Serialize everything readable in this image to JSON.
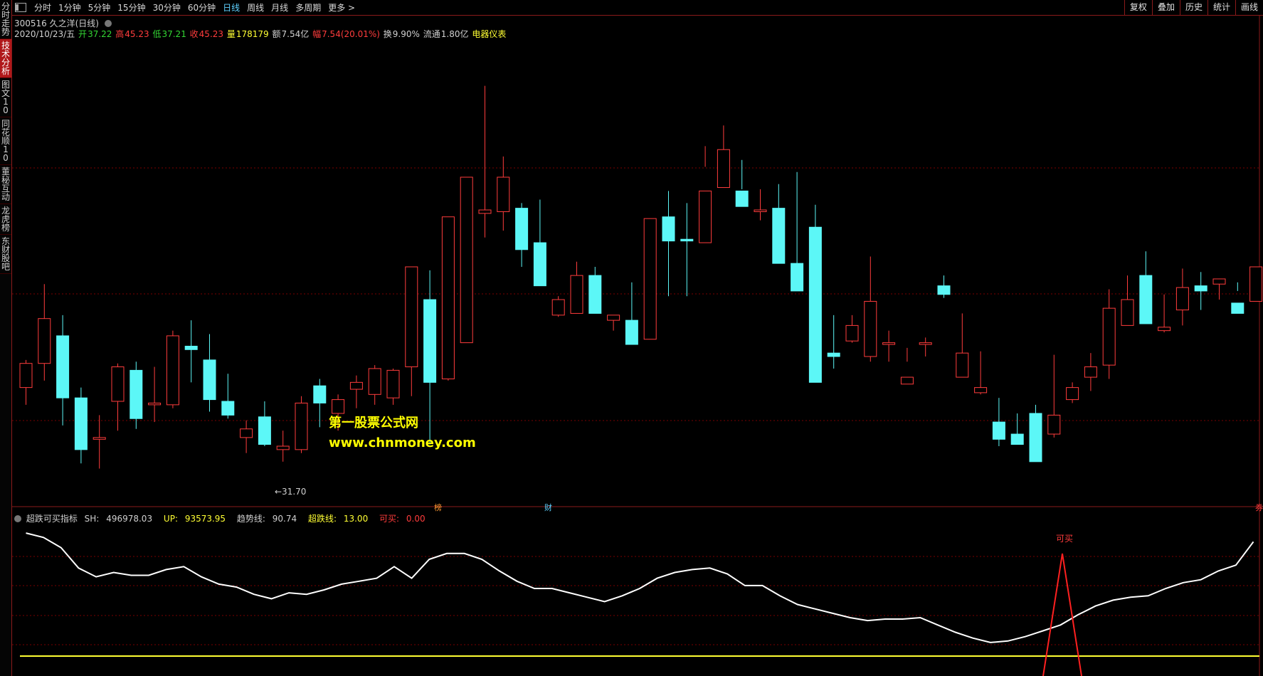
{
  "left_tabs": [
    {
      "label": "分时走势",
      "active": false
    },
    {
      "label": "技术分析",
      "active": true
    },
    {
      "label": "图文10",
      "active": false
    },
    {
      "label": "同花顺10",
      "active": false
    },
    {
      "label": "董秘互动",
      "active": false
    },
    {
      "label": "龙虎榜",
      "active": false
    },
    {
      "label": "东财股吧",
      "active": false
    }
  ],
  "period_tabs": [
    "分时",
    "1分钟",
    "5分钟",
    "15分钟",
    "30分钟",
    "60分钟",
    "日线",
    "周线",
    "月线",
    "多周期",
    "更多 >"
  ],
  "active_period": "日线",
  "right_tools": [
    "复权",
    "叠加",
    "历史",
    "统计",
    "画线"
  ],
  "stock": {
    "title": "300516 久之洋(日线)"
  },
  "quote": {
    "date": "2020/10/23/五",
    "open_label": "开",
    "open": "37.22",
    "high_label": "高",
    "high": "45.23",
    "low_label": "低",
    "low": "37.21",
    "close_label": "收",
    "close": "45.23",
    "vol_label": "量",
    "vol": "178179",
    "amount_label": "额",
    "amount": "7.54亿",
    "change_label": "幅",
    "change": "7.54(20.01%)",
    "turnover_label": "换",
    "turnover": "9.90%",
    "float_label": "流通",
    "float": "1.80亿",
    "sector": "电器仪表"
  },
  "price_chart": {
    "low_marker": "←31.70",
    "event_marks": [
      {
        "text": "榜",
        "color": "#ff9933"
      },
      {
        "text": "财",
        "color": "#5ed1ff"
      },
      {
        "text": "券",
        "color": "#ff3c3c"
      }
    ],
    "colors": {
      "up": "#ff3c3c",
      "down": "#5cf7f7",
      "grid": "#7a0000"
    }
  },
  "watermark": {
    "line1": "第一股票公式网",
    "line2": "www.chnmoney.com"
  },
  "indicator": {
    "name": "超跌可买指标",
    "sh_label": "SH:",
    "sh": "496978.03",
    "up_label": "UP:",
    "up": "93573.95",
    "trend_label": "趋势线:",
    "trend": "90.74",
    "oversold_label": "超跌线:",
    "oversold": "13.00",
    "buy_label": "可买:",
    "buy": "0.00",
    "buy_signal": "可买"
  },
  "chart_data": {
    "type": "candlestick",
    "title": "300516 久之洋(日线)",
    "candles_ohlc": [
      [
        36.0,
        37.6,
        35.0,
        37.4
      ],
      [
        37.4,
        42.0,
        36.4,
        40.0
      ],
      [
        39.0,
        40.2,
        33.8,
        35.4
      ],
      [
        35.4,
        36.0,
        31.6,
        32.4
      ],
      [
        33.0,
        34.4,
        31.3,
        33.1
      ],
      [
        35.2,
        37.4,
        33.5,
        37.2
      ],
      [
        37.0,
        37.5,
        33.6,
        34.2
      ],
      [
        35.0,
        37.2,
        34.0,
        35.1
      ],
      [
        35.0,
        39.3,
        34.8,
        39.0
      ],
      [
        38.4,
        39.9,
        36.3,
        38.2
      ],
      [
        37.6,
        39.1,
        34.6,
        35.3
      ],
      [
        35.2,
        36.8,
        34.2,
        34.4
      ],
      [
        33.1,
        34.1,
        32.2,
        33.6
      ],
      [
        34.3,
        35.2,
        32.6,
        32.7
      ],
      [
        32.4,
        33.5,
        31.7,
        32.6
      ],
      [
        32.4,
        35.5,
        32.2,
        35.1
      ],
      [
        36.1,
        36.5,
        33.7,
        35.1
      ],
      [
        34.5,
        35.6,
        33.5,
        35.3
      ],
      [
        35.9,
        36.7,
        34.8,
        36.3
      ],
      [
        35.6,
        37.3,
        35.0,
        37.1
      ],
      [
        35.4,
        37.1,
        35.0,
        37.0
      ],
      [
        37.2,
        42.3,
        35.5,
        43.0
      ],
      [
        41.1,
        42.8,
        32.7,
        36.3
      ],
      [
        36.5,
        45.0,
        36.4,
        45.9
      ],
      [
        38.6,
        48.2,
        38.8,
        48.2
      ],
      [
        46.1,
        53.5,
        44.7,
        46.3
      ],
      [
        46.2,
        49.4,
        45.1,
        48.2
      ],
      [
        46.4,
        46.7,
        43.0,
        44.0
      ],
      [
        44.4,
        46.9,
        43.9,
        41.9
      ],
      [
        40.2,
        41.3,
        40.1,
        41.1
      ],
      [
        40.3,
        43.3,
        40.4,
        42.5
      ],
      [
        42.5,
        43.0,
        40.3,
        40.3
      ],
      [
        39.9,
        40.1,
        39.3,
        40.2
      ],
      [
        39.9,
        42.1,
        38.7,
        38.5
      ],
      [
        38.8,
        45.8,
        41.8,
        45.8
      ],
      [
        45.9,
        47.4,
        41.3,
        44.5
      ],
      [
        44.6,
        46.7,
        41.3,
        44.5
      ],
      [
        44.4,
        50.0,
        48.8,
        47.4
      ],
      [
        47.6,
        51.2,
        47.6,
        49.8
      ],
      [
        47.4,
        49.2,
        47.5,
        46.5
      ],
      [
        46.2,
        47.5,
        45.7,
        46.3
      ],
      [
        46.4,
        47.8,
        45.8,
        43.2
      ],
      [
        43.2,
        48.5,
        42.5,
        41.6
      ],
      [
        45.3,
        46.6,
        36.5,
        36.3
      ],
      [
        38.0,
        40.2,
        37.1,
        37.8
      ],
      [
        38.7,
        40.2,
        38.6,
        39.6
      ],
      [
        37.8,
        43.6,
        37.5,
        41.0
      ],
      [
        38.5,
        39.3,
        37.5,
        38.6
      ],
      [
        36.2,
        38.3,
        37.5,
        36.6
      ],
      [
        38.5,
        38.9,
        37.8,
        38.6
      ],
      [
        41.9,
        42.5,
        41.2,
        41.4
      ],
      [
        36.6,
        40.3,
        37.8,
        38.0
      ],
      [
        35.7,
        38.1,
        35.6,
        36.0
      ],
      [
        34.0,
        35.4,
        32.6,
        33.0
      ],
      [
        33.3,
        34.5,
        33.2,
        32.7
      ],
      [
        34.5,
        35.0,
        31.8,
        31.7
      ],
      [
        33.3,
        37.9,
        33.1,
        34.4
      ],
      [
        35.3,
        36.3,
        35.1,
        36.0
      ],
      [
        36.6,
        38.0,
        35.8,
        37.2
      ],
      [
        37.3,
        41.7,
        36.5,
        40.6
      ],
      [
        39.6,
        42.5,
        40.9,
        41.1
      ],
      [
        42.5,
        43.9,
        42.0,
        39.7
      ],
      [
        39.3,
        41.4,
        39.2,
        39.5
      ],
      [
        40.5,
        42.9,
        39.6,
        41.8
      ],
      [
        41.9,
        42.7,
        40.5,
        41.6
      ],
      [
        42.0,
        42.3,
        41.1,
        42.3
      ],
      [
        40.9,
        42.1,
        41.6,
        40.3
      ],
      [
        41.0,
        42.5,
        41.0,
        43.0
      ],
      [
        42.5,
        45.2,
        42.0,
        45.2
      ]
    ]
  }
}
